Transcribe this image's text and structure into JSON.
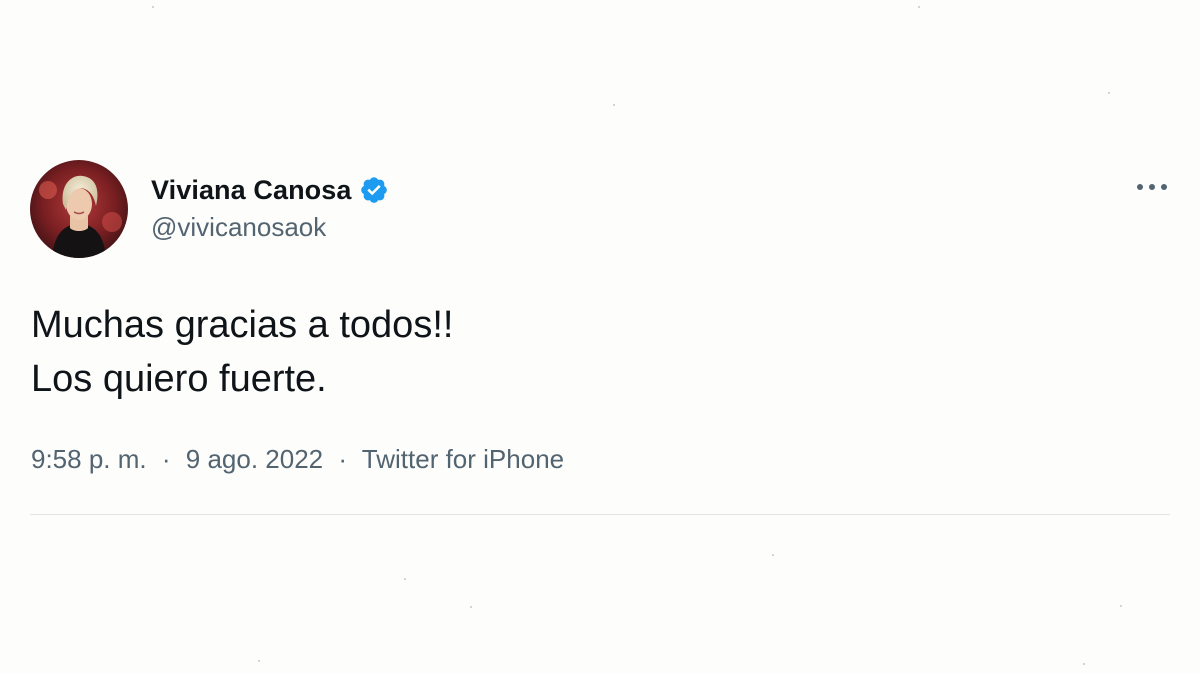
{
  "author": {
    "display_name": "Viviana Canosa",
    "handle": "@vivicanosaok",
    "verified": true
  },
  "tweet": {
    "lines": [
      "Muchas gracias a todos!!",
      "Los quiero fuerte."
    ]
  },
  "meta": {
    "time": "9:58 p. m.",
    "separator": "·",
    "date": "9 ago. 2022",
    "source": "Twitter for iPhone"
  },
  "colors": {
    "text_primary": "#0f1419",
    "text_secondary": "#536471",
    "verified_badge": "#1d9bf0",
    "divider": "#e3e6e8"
  },
  "icons": {
    "verified": "verified-badge-icon",
    "more": "more-options-icon"
  }
}
